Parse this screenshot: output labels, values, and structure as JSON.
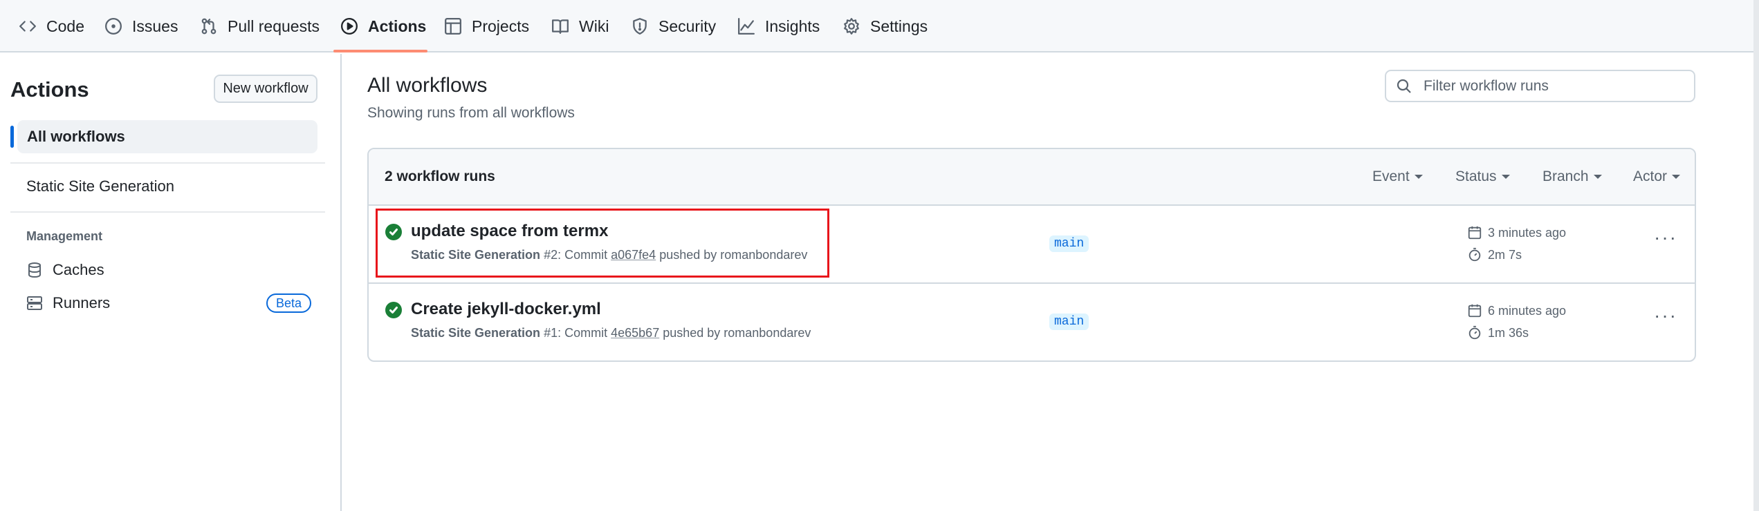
{
  "nav": {
    "tabs": [
      {
        "label": "Code",
        "icon": "code-icon"
      },
      {
        "label": "Issues",
        "icon": "issue-opened-icon"
      },
      {
        "label": "Pull requests",
        "icon": "git-pull-request-icon"
      },
      {
        "label": "Actions",
        "icon": "play-icon",
        "active": true
      },
      {
        "label": "Projects",
        "icon": "table-icon"
      },
      {
        "label": "Wiki",
        "icon": "book-icon"
      },
      {
        "label": "Security",
        "icon": "shield-icon"
      },
      {
        "label": "Insights",
        "icon": "graph-icon"
      },
      {
        "label": "Settings",
        "icon": "gear-icon"
      }
    ],
    "active_underline_color": "#fd8c73"
  },
  "sidebar": {
    "title": "Actions",
    "new_workflow_label": "New workflow",
    "all_workflows_label": "All workflows",
    "workflows": [
      "Static Site Generation"
    ],
    "management_heading": "Management",
    "management_items": [
      {
        "label": "Caches",
        "icon": "database-icon"
      },
      {
        "label": "Runners",
        "icon": "server-icon",
        "badge": "Beta"
      }
    ]
  },
  "main": {
    "title": "All workflows",
    "subtitle": "Showing runs from all workflows",
    "filter_placeholder": "Filter workflow runs",
    "runs_count_label": "2 workflow runs",
    "filters": [
      "Event",
      "Status",
      "Branch",
      "Actor"
    ],
    "runs": [
      {
        "title": "update space from termx",
        "workflow": "Static Site Generation",
        "run_number": "#2",
        "commit_prefix": ": Commit ",
        "sha": "a067fe4",
        "pushed_by": " pushed by romanbondarev",
        "branch": "main",
        "time_ago": "3 minutes ago",
        "duration": "2m 7s",
        "status": "success",
        "highlighted": true
      },
      {
        "title": "Create jekyll-docker.yml",
        "workflow": "Static Site Generation",
        "run_number": "#1",
        "commit_prefix": ": Commit ",
        "sha": "4e65b67",
        "pushed_by": " pushed by romanbondarev",
        "branch": "main",
        "time_ago": "6 minutes ago",
        "duration": "1m 36s",
        "status": "success"
      }
    ],
    "kebab_glyph": "···"
  },
  "colors": {
    "success": "#1a7f37",
    "link": "#0969da",
    "highlight_box": "#e8151b"
  }
}
